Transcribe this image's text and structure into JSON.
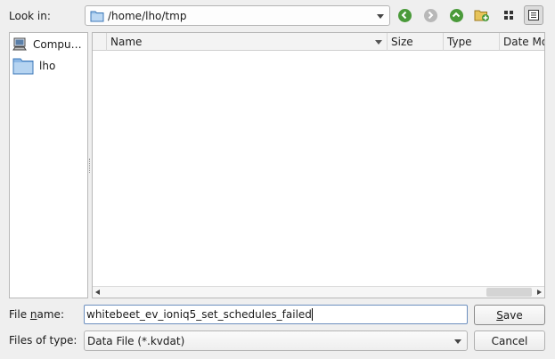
{
  "look_in": {
    "label": "Look in:",
    "path": "/home/lho/tmp"
  },
  "toolbar": {
    "back_icon": "back-arrow-icon",
    "forward_icon": "forward-arrow-icon",
    "up_icon": "up-arrow-icon",
    "new_folder_icon": "new-folder-icon",
    "list_view_icon": "list-view-icon",
    "detail_view_icon": "detail-view-icon"
  },
  "sidebar": {
    "items": [
      {
        "label": "Compu…",
        "icon": "computer-icon"
      },
      {
        "label": "lho",
        "icon": "folder-icon"
      }
    ]
  },
  "file_list": {
    "columns": [
      {
        "label": "Name"
      },
      {
        "label": "Size"
      },
      {
        "label": "Type"
      },
      {
        "label": "Date Mo"
      }
    ],
    "rows": []
  },
  "file_name": {
    "label_pre": "File ",
    "label_mnemonic": "n",
    "label_post": "ame:",
    "value": "whitebeet_ev_ioniq5_set_schedules_failed"
  },
  "file_type": {
    "label": "Files of type:",
    "value": "Data File (*.kvdat)"
  },
  "buttons": {
    "save_mnemonic": "S",
    "save_rest": "ave",
    "cancel": "Cancel"
  },
  "colors": {
    "accent": "#6c8fbf",
    "green_nav": "#4a9a3a",
    "gray_nav": "#b8b8b8"
  }
}
